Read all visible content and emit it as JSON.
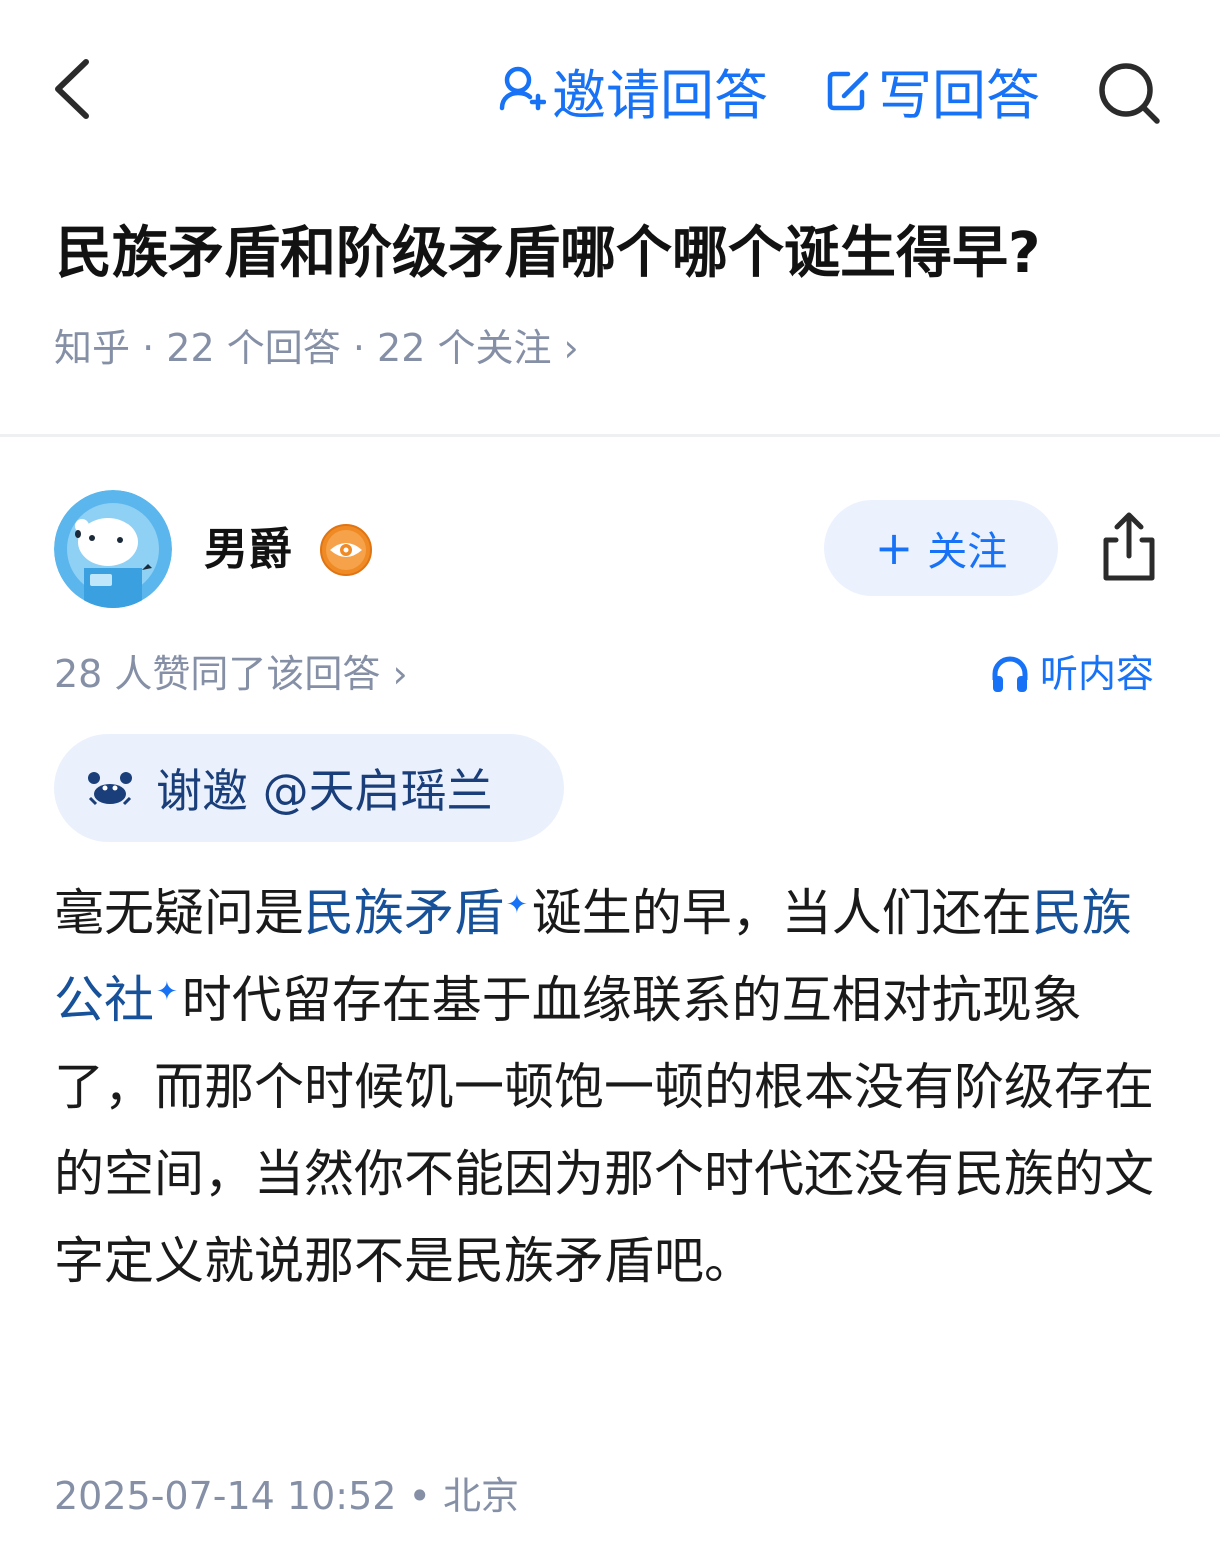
{
  "topbar": {
    "back_icon": "chevron-left-icon",
    "invite_label": "邀请回答",
    "write_label": "写回答",
    "search_icon": "search-icon"
  },
  "question": {
    "title": "民族矛盾和阶级矛盾哪个哪个诞生得早?",
    "source": "知乎",
    "answers": "22 个回答",
    "followers": "22 个关注",
    "sep": "·",
    "chevron": "›"
  },
  "author": {
    "name": "男爵",
    "avatar_icon": "polar-bear-avatar",
    "badge_icon": "eye-badge-icon",
    "follow_label": "关注",
    "share_icon": "share-icon"
  },
  "answer": {
    "votes": "28 人赞同了该回答",
    "votes_chevron": "›",
    "listen_label": "听内容",
    "thanks_label": "谢邀 @天启瑶兰",
    "content": {
      "part1": "毫无疑问是",
      "kw1": "民族矛盾",
      "part2": "诞生的早，当人们还在",
      "kw2": "民族公社",
      "part3": "时代留存在基于血缘联系的互相对抗现象了，而那个时候饥一顿饱一顿的根本没有阶级存在的空间，当然你不能因为那个时代还没有民族的文字定义就说那不是民族矛盾吧。",
      "spark": "✦"
    },
    "datetime": "2025-07-14 10:52",
    "dot": "•",
    "location": "北京"
  },
  "colors": {
    "accent": "#1772f6",
    "keyword": "#175199",
    "meta": "#8590a6",
    "pill_bg": "#eaf1fc",
    "badge": "#f08a24"
  }
}
